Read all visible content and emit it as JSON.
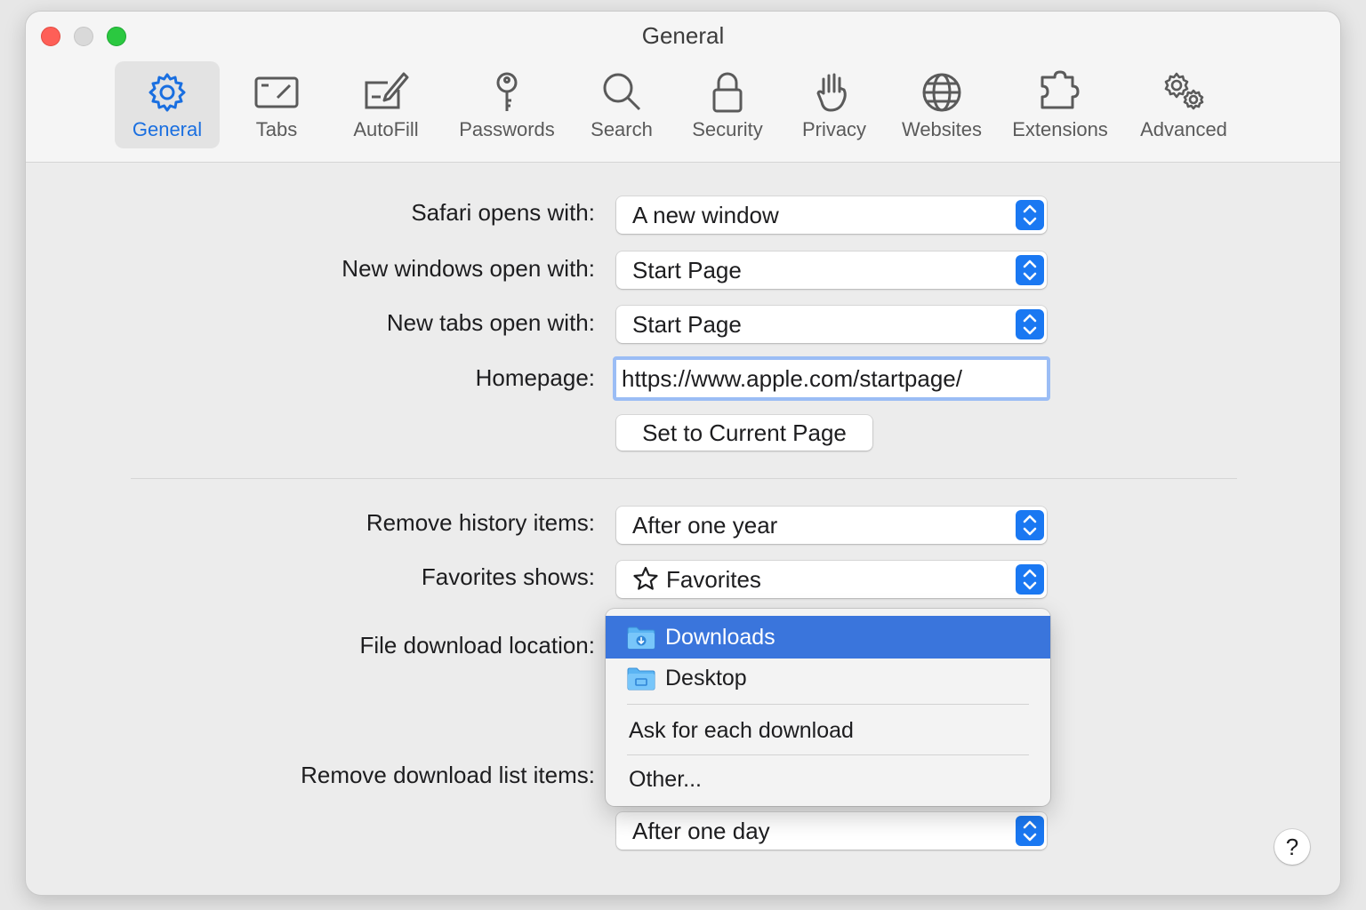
{
  "window": {
    "title": "General"
  },
  "toolbar": {
    "items": [
      {
        "label": "General",
        "icon": "gear-icon",
        "active": true
      },
      {
        "label": "Tabs",
        "icon": "tabs-icon"
      },
      {
        "label": "AutoFill",
        "icon": "autofill-icon"
      },
      {
        "label": "Passwords",
        "icon": "key-icon"
      },
      {
        "label": "Search",
        "icon": "magnifier-icon"
      },
      {
        "label": "Security",
        "icon": "lock-icon"
      },
      {
        "label": "Privacy",
        "icon": "hand-icon"
      },
      {
        "label": "Websites",
        "icon": "globe-icon"
      },
      {
        "label": "Extensions",
        "icon": "puzzle-icon"
      },
      {
        "label": "Advanced",
        "icon": "gears-icon"
      }
    ]
  },
  "settings": {
    "safari_opens_with": {
      "label": "Safari opens with:",
      "value": "A new window"
    },
    "new_windows_open_with": {
      "label": "New windows open with:",
      "value": "Start Page"
    },
    "new_tabs_open_with": {
      "label": "New tabs open with:",
      "value": "Start Page"
    },
    "homepage": {
      "label": "Homepage:",
      "value": "https://www.apple.com/startpage/"
    },
    "set_current_page_label": "Set to Current Page",
    "remove_history_items": {
      "label": "Remove history items:",
      "value": "After one year"
    },
    "favorites_shows": {
      "label": "Favorites shows:",
      "value": "Favorites"
    },
    "file_download_location": {
      "label": "File download location:"
    },
    "remove_download_list_items": {
      "label": "Remove download list items:",
      "value": "After one day"
    }
  },
  "download_menu": {
    "items": [
      {
        "label": "Downloads",
        "icon": "downloads-folder-icon",
        "selected": true
      },
      {
        "label": "Desktop",
        "icon": "desktop-folder-icon"
      },
      {
        "label": "Ask for each download"
      },
      {
        "label": "Other..."
      }
    ]
  },
  "help": {
    "label": "?"
  },
  "colors": {
    "accent": "#1a78f2",
    "selection": "#3a75dc",
    "active_tab_text": "#1a6fe0"
  }
}
